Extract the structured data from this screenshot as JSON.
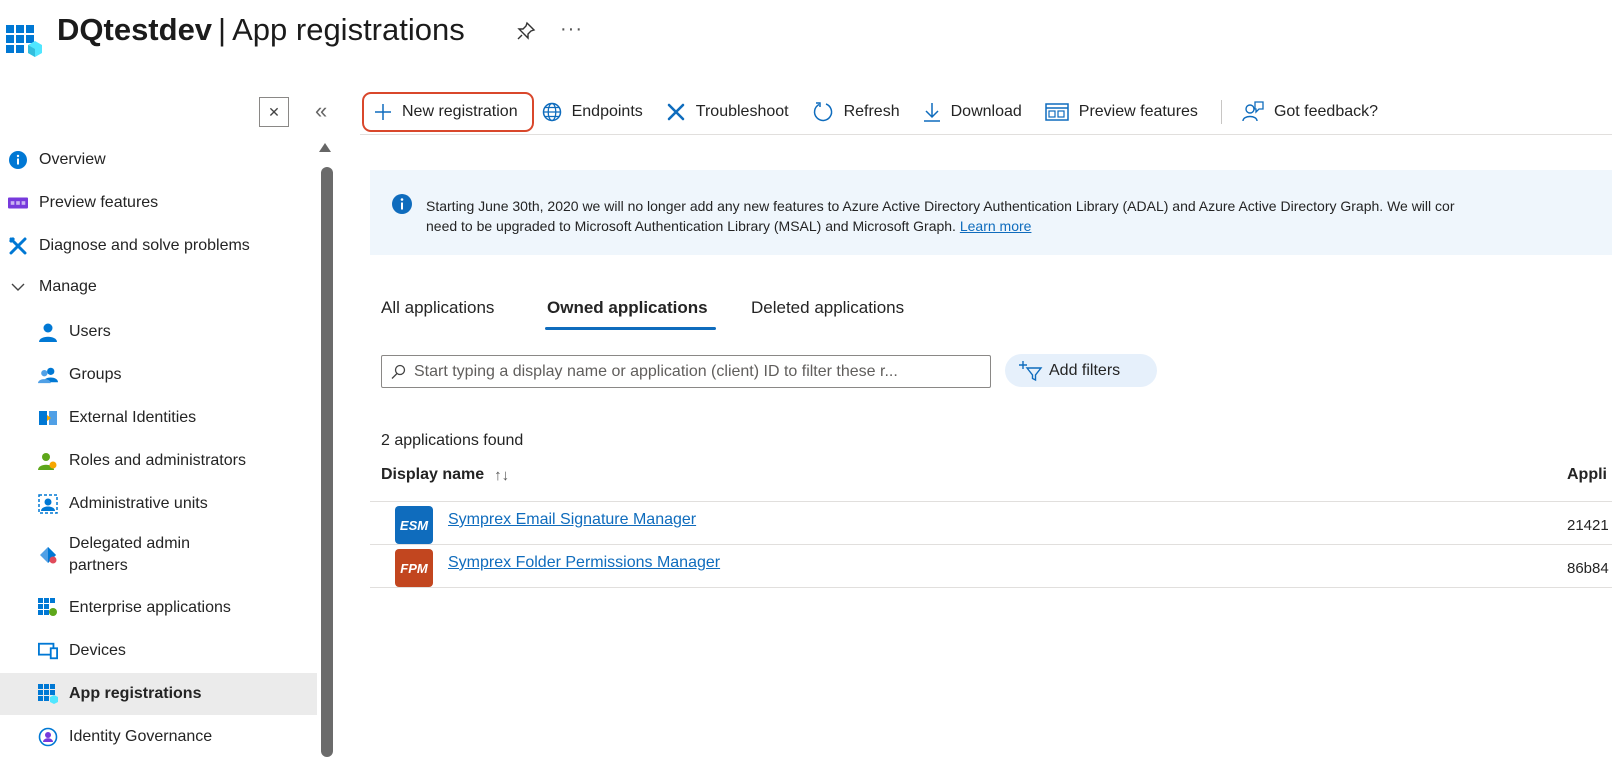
{
  "header": {
    "tenant": "DQtestdev",
    "separator": "|",
    "page": "App registrations",
    "more": "···"
  },
  "sidebar": {
    "collapse_x": "✕",
    "collapse_chevron": "«",
    "items": [
      {
        "label": "Overview",
        "icon": "info-icon"
      },
      {
        "label": "Preview features",
        "icon": "preview-icon"
      },
      {
        "label": "Diagnose and solve problems",
        "icon": "wrench-icon"
      },
      {
        "label": "Manage",
        "icon": "chevron-down-icon"
      },
      {
        "label": "Users",
        "icon": "user-icon"
      },
      {
        "label": "Groups",
        "icon": "groups-icon"
      },
      {
        "label": "External Identities",
        "icon": "external-identities-icon"
      },
      {
        "label": "Roles and administrators",
        "icon": "roles-icon"
      },
      {
        "label": "Administrative units",
        "icon": "admin-units-icon"
      },
      {
        "label": "Delegated admin",
        "label2": "partners",
        "icon": "delegated-admin-icon"
      },
      {
        "label": "Enterprise applications",
        "icon": "enterprise-apps-icon"
      },
      {
        "label": "Devices",
        "icon": "devices-icon"
      },
      {
        "label": "App registrations",
        "icon": "app-registrations-icon"
      },
      {
        "label": "Identity Governance",
        "icon": "identity-governance-icon"
      }
    ]
  },
  "toolbar": {
    "new_registration": "New registration",
    "endpoints": "Endpoints",
    "troubleshoot": "Troubleshoot",
    "refresh": "Refresh",
    "download": "Download",
    "preview_features": "Preview features",
    "got_feedback": "Got feedback?"
  },
  "banner": {
    "line1": "Starting June 30th, 2020 we will no longer add any new features to Azure Active Directory Authentication Library (ADAL) and Azure Active Directory Graph. We will cor",
    "line2": "need to be upgraded to Microsoft Authentication Library (MSAL) and Microsoft Graph.",
    "link": "Learn more"
  },
  "tabs": {
    "all": "All applications",
    "owned": "Owned applications",
    "deleted": "Deleted applications"
  },
  "search": {
    "placeholder": "Start typing a display name or application (client) ID to filter these r..."
  },
  "filters": {
    "add_label": "Add filters"
  },
  "results": {
    "count": "2 applications found",
    "col_display_name": "Display name",
    "col_sort": "↑↓",
    "col_app_id": "Appli",
    "rows": [
      {
        "badge": "ESM",
        "badge_color": "#0f6cbd",
        "name": "Symprex Email Signature Manager",
        "app_id": "21421"
      },
      {
        "badge": "FPM",
        "badge_color": "#c2461f",
        "name": "Symprex Folder Permissions Manager",
        "app_id": "86b84"
      }
    ]
  },
  "colors": {
    "accent": "#0f6cbd",
    "highlight_outline": "#d9472b",
    "banner_bg": "#eff6fc"
  }
}
